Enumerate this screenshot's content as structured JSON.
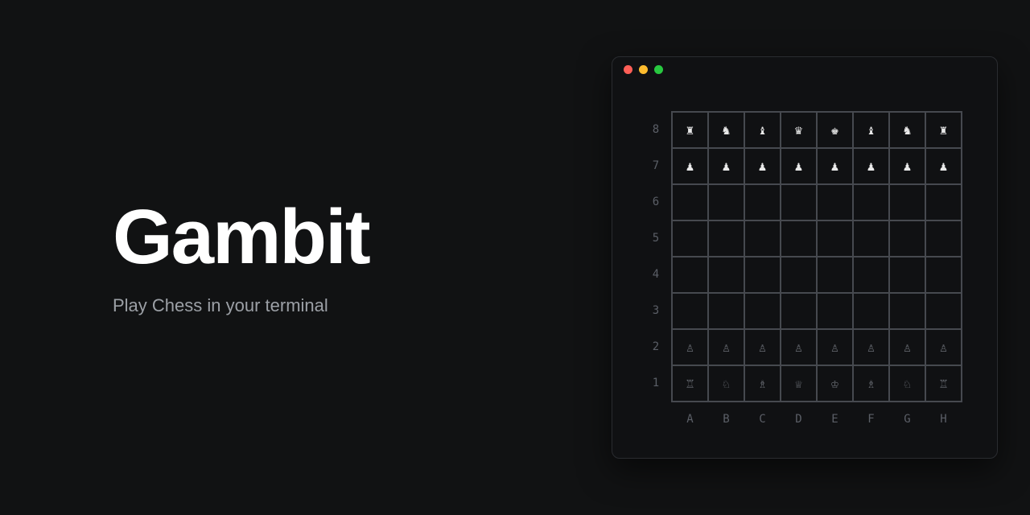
{
  "hero": {
    "title": "Gambit",
    "subtitle": "Play Chess in your terminal"
  },
  "window": {
    "traffic_lights": [
      "close",
      "minimize",
      "zoom"
    ]
  },
  "board": {
    "files": [
      "A",
      "B",
      "C",
      "D",
      "E",
      "F",
      "G",
      "H"
    ],
    "ranks": [
      "8",
      "7",
      "6",
      "5",
      "4",
      "3",
      "2",
      "1"
    ],
    "rows": [
      [
        {
          "p": "♜",
          "c": "w"
        },
        {
          "p": "♞",
          "c": "w"
        },
        {
          "p": "♝",
          "c": "w"
        },
        {
          "p": "♛",
          "c": "w"
        },
        {
          "p": "♚",
          "c": "w"
        },
        {
          "p": "♝",
          "c": "w"
        },
        {
          "p": "♞",
          "c": "w"
        },
        {
          "p": "♜",
          "c": "w"
        }
      ],
      [
        {
          "p": "♟",
          "c": "w"
        },
        {
          "p": "♟",
          "c": "w"
        },
        {
          "p": "♟",
          "c": "w"
        },
        {
          "p": "♟",
          "c": "w"
        },
        {
          "p": "♟",
          "c": "w"
        },
        {
          "p": "♟",
          "c": "w"
        },
        {
          "p": "♟",
          "c": "w"
        },
        {
          "p": "♟",
          "c": "w"
        }
      ],
      [
        {
          "p": "",
          "c": ""
        },
        {
          "p": "",
          "c": ""
        },
        {
          "p": "",
          "c": ""
        },
        {
          "p": "",
          "c": ""
        },
        {
          "p": "",
          "c": ""
        },
        {
          "p": "",
          "c": ""
        },
        {
          "p": "",
          "c": ""
        },
        {
          "p": "",
          "c": ""
        }
      ],
      [
        {
          "p": "",
          "c": ""
        },
        {
          "p": "",
          "c": ""
        },
        {
          "p": "",
          "c": ""
        },
        {
          "p": "",
          "c": ""
        },
        {
          "p": "",
          "c": ""
        },
        {
          "p": "",
          "c": ""
        },
        {
          "p": "",
          "c": ""
        },
        {
          "p": "",
          "c": ""
        }
      ],
      [
        {
          "p": "",
          "c": ""
        },
        {
          "p": "",
          "c": ""
        },
        {
          "p": "",
          "c": ""
        },
        {
          "p": "",
          "c": ""
        },
        {
          "p": "",
          "c": ""
        },
        {
          "p": "",
          "c": ""
        },
        {
          "p": "",
          "c": ""
        },
        {
          "p": "",
          "c": ""
        }
      ],
      [
        {
          "p": "",
          "c": ""
        },
        {
          "p": "",
          "c": ""
        },
        {
          "p": "",
          "c": ""
        },
        {
          "p": "",
          "c": ""
        },
        {
          "p": "",
          "c": ""
        },
        {
          "p": "",
          "c": ""
        },
        {
          "p": "",
          "c": ""
        },
        {
          "p": "",
          "c": ""
        }
      ],
      [
        {
          "p": "♙",
          "c": "b"
        },
        {
          "p": "♙",
          "c": "b"
        },
        {
          "p": "♙",
          "c": "b"
        },
        {
          "p": "♙",
          "c": "b"
        },
        {
          "p": "♙",
          "c": "b"
        },
        {
          "p": "♙",
          "c": "b"
        },
        {
          "p": "♙",
          "c": "b"
        },
        {
          "p": "♙",
          "c": "b"
        }
      ],
      [
        {
          "p": "♖",
          "c": "b"
        },
        {
          "p": "♘",
          "c": "b"
        },
        {
          "p": "♗",
          "c": "b"
        },
        {
          "p": "♕",
          "c": "b"
        },
        {
          "p": "♔",
          "c": "b"
        },
        {
          "p": "♗",
          "c": "b"
        },
        {
          "p": "♘",
          "c": "b"
        },
        {
          "p": "♖",
          "c": "b"
        }
      ]
    ]
  }
}
